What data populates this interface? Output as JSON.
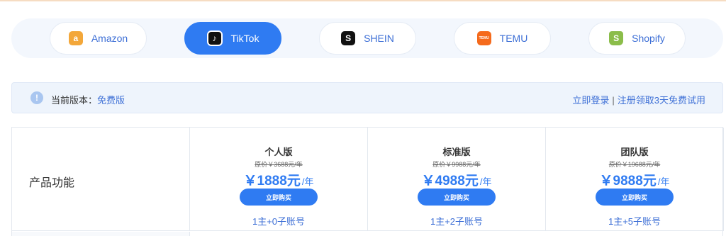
{
  "platform_tabs": [
    {
      "label": "Amazon",
      "icon": "amazon-icon",
      "icon_glyph": "a",
      "active": false
    },
    {
      "label": "TikTok",
      "icon": "tiktok-icon",
      "icon_glyph": "♪",
      "active": true
    },
    {
      "label": "SHEIN",
      "icon": "shein-icon",
      "icon_glyph": "S",
      "active": false
    },
    {
      "label": "TEMU",
      "icon": "temu-icon",
      "icon_glyph": "TEMU",
      "active": false
    },
    {
      "label": "Shopify",
      "icon": "shopify-icon",
      "icon_glyph": "S",
      "active": false
    }
  ],
  "notice": {
    "label": "当前版本：",
    "version": "免费版",
    "login_link": "立即登录",
    "separator": "|",
    "register_link": "注册领取3天免费试用"
  },
  "pricing": {
    "feature_title": "产品功能",
    "plans": [
      {
        "name": "个人版",
        "original_price": "原价￥3688元/年",
        "price": "￥1888元",
        "unit": "/年",
        "buy_label": "立即购买",
        "accounts": "1主+0子账号"
      },
      {
        "name": "标准版",
        "original_price": "原价￥9988元/年",
        "price": "￥4988元",
        "unit": "/年",
        "buy_label": "立即购买",
        "accounts": "1主+2子账号"
      },
      {
        "name": "团队版",
        "original_price": "原价￥19688元/年",
        "price": "￥9888元",
        "unit": "/年",
        "buy_label": "立即购买",
        "accounts": "1主+5子账号"
      }
    ]
  },
  "colors": {
    "accent": "#2f7bf2",
    "link": "#3d6fd6",
    "notice_bg": "#eef4fc"
  }
}
